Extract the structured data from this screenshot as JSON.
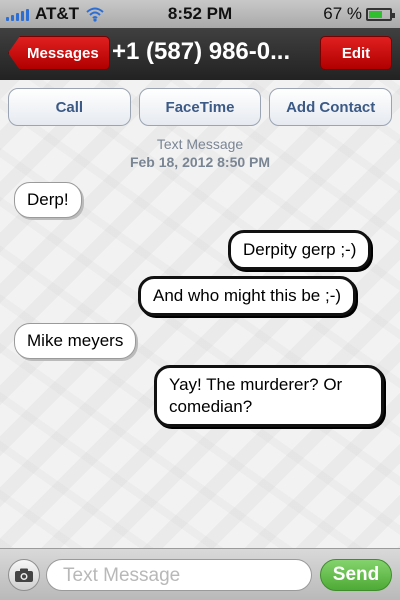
{
  "status_bar": {
    "carrier": "AT&T",
    "time": "8:52 PM",
    "battery_percent_label": "67 %",
    "battery_level": 0.67
  },
  "nav": {
    "back_label": "Messages",
    "title": "+1 (587) 986-0...",
    "edit_label": "Edit"
  },
  "actions": [
    {
      "label": "Call"
    },
    {
      "label": "FaceTime"
    },
    {
      "label": "Add Contact"
    }
  ],
  "thread": {
    "service_label": "Text Message",
    "timestamp": "Feb 18, 2012 8:50 PM"
  },
  "messages": [
    {
      "direction": "incoming",
      "text": "Derp!"
    },
    {
      "direction": "outgoing",
      "text": "Derpity gerp ;-)"
    },
    {
      "direction": "outgoing",
      "text": "And who might this be ;-)"
    },
    {
      "direction": "incoming",
      "text": "Mike meyers"
    },
    {
      "direction": "outgoing",
      "text": "Yay! The murderer? Or comedian?"
    }
  ],
  "composer": {
    "placeholder": "Text Message",
    "send_label": "Send",
    "camera_icon": "camera-icon"
  },
  "colors": {
    "nav_red": "#d81a1a",
    "send_green": "#5fbe45",
    "action_text_blue": "#3c5a86"
  }
}
